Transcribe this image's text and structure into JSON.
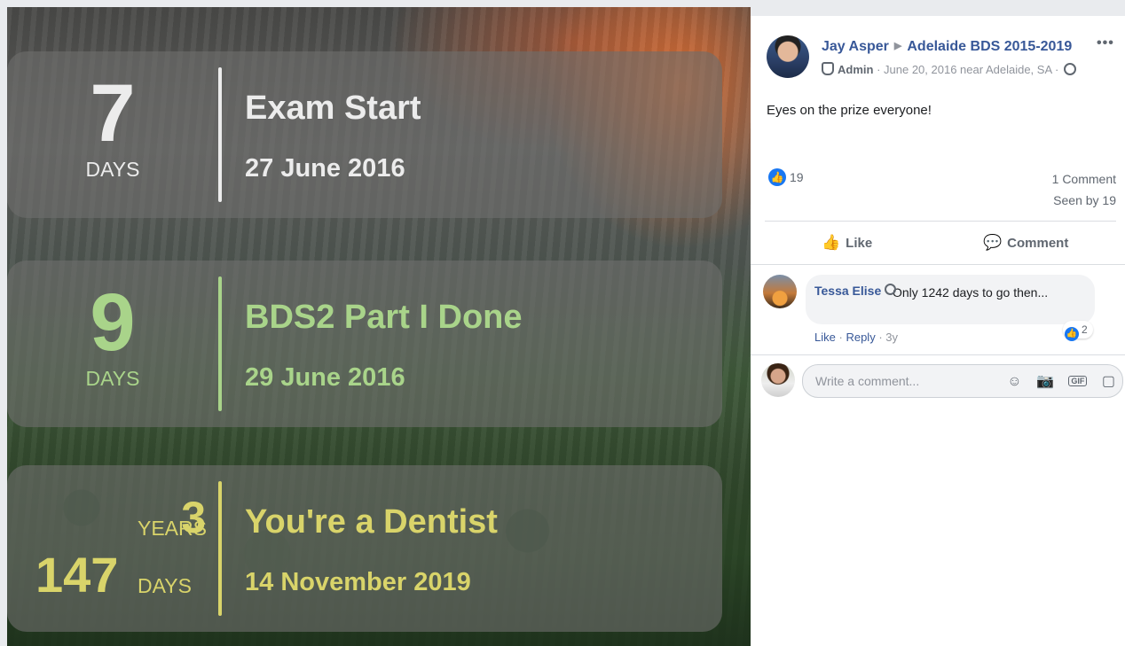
{
  "countdowns": [
    {
      "number": "7",
      "unit": "DAYS",
      "title": "Exam Start",
      "date": "27 June 2016",
      "color": "#ececec"
    },
    {
      "number": "9",
      "unit": "DAYS",
      "title": "BDS2 Part I Done",
      "date": "29 June 2016",
      "color": "#a9d48a"
    },
    {
      "years": "3",
      "years_unit": "YEARS",
      "days": "147",
      "days_unit": "DAYS",
      "title": "You're a Dentist",
      "date": "14 November 2019",
      "color": "#d9d46a"
    }
  ],
  "post": {
    "author": "Jay Asper",
    "group": "Adelaide BDS 2015-2019",
    "more": "•••",
    "role": "Admin",
    "meta": "· June 20, 2016 near Adelaide, SA ·",
    "message": "Eyes on the prize everyone!",
    "like_count": "19",
    "comment_count": "1 Comment",
    "seen": "Seen by 19",
    "like_label": "Like",
    "comment_label": "Comment"
  },
  "comment": {
    "name": "Tessa Elise",
    "text": "Only 1242 days to go then...",
    "reactions": "2",
    "like": "Like",
    "reply": "Reply",
    "age": "3y"
  },
  "composer": {
    "placeholder": "Write a comment..."
  }
}
